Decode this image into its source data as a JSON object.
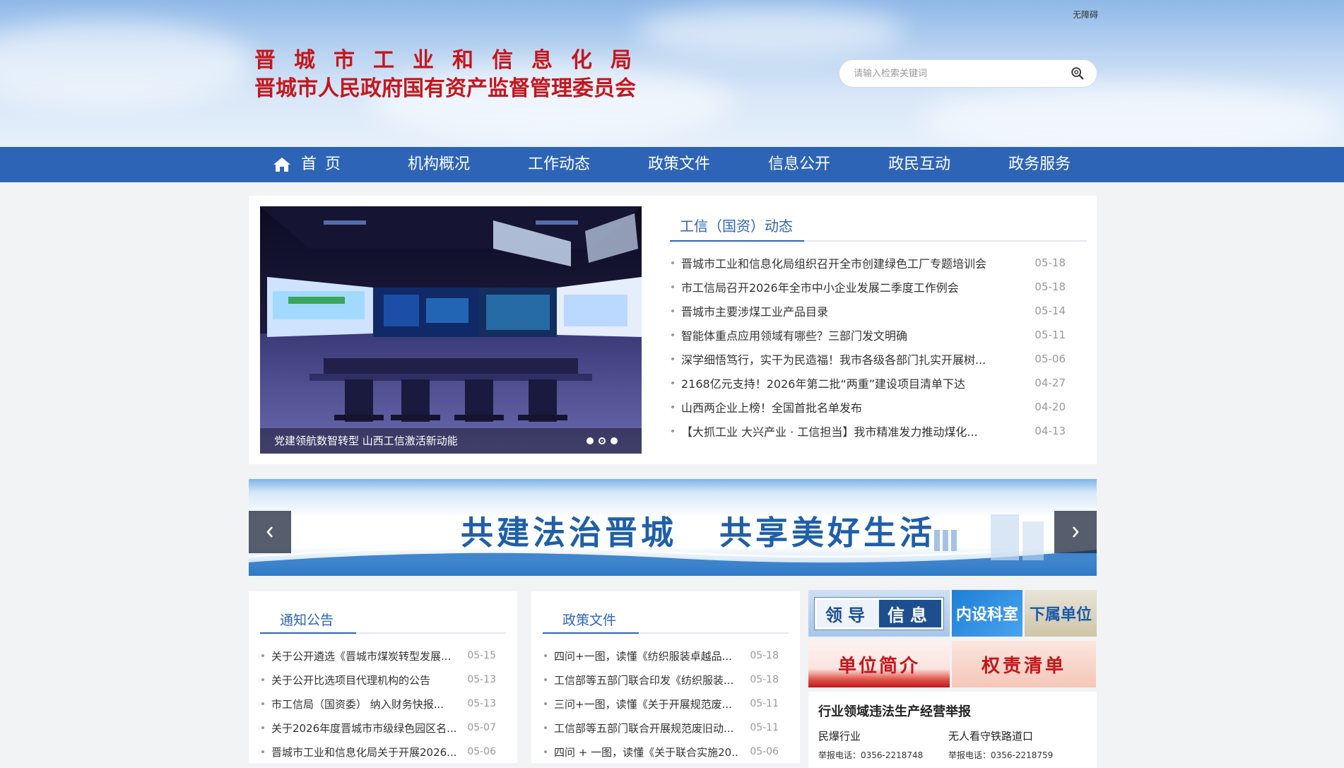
{
  "header": {
    "accessibility_label": "无障碍",
    "title_line1": "晋城市工业和信息化局",
    "title_line2": "晋城市人民政府国有资产监督管理委员会",
    "search_placeholder": "请输入检索关键词",
    "title_color": "#c4161c"
  },
  "nav": {
    "items": [
      {
        "label": "首页",
        "icon": "home-icon"
      },
      {
        "label": "机构概况"
      },
      {
        "label": "工作动态"
      },
      {
        "label": "政策文件"
      },
      {
        "label": "信息公开"
      },
      {
        "label": "政民互动"
      },
      {
        "label": "政务服务"
      }
    ],
    "bg_color": "#2d64b6"
  },
  "slider": {
    "caption": "党建领航数智转型 山西工信激活新动能",
    "active_dot": 1,
    "dot_count": 3
  },
  "news": {
    "title": "工信（国资）动态",
    "items": [
      {
        "text": "晋城市工业和信息化局组织召开全市创建绿色工厂专题培训会",
        "date": "05-18"
      },
      {
        "text": "市工信局召开2026年全市中小企业发展二季度工作例会",
        "date": "05-18"
      },
      {
        "text": "晋城市主要涉煤工业产品目录",
        "date": "05-14"
      },
      {
        "text": "智能体重点应用领域有哪些？三部门发文明确",
        "date": "05-11"
      },
      {
        "text": "深学细悟笃行，实干为民造福！我市各级各部门扎实开展树...",
        "date": "05-06"
      },
      {
        "text": "2168亿元支持！2026年第二批“两重”建设项目清单下达",
        "date": "04-27"
      },
      {
        "text": "山西两企业上榜！全国首批名单发布",
        "date": "04-20"
      },
      {
        "text": "【大抓工业 大兴产业 · 工信担当】我市精准发力推动煤化...",
        "date": "04-13"
      }
    ]
  },
  "banner": {
    "slogan_left": "共建法治晋城",
    "slogan_right": "共享美好生活"
  },
  "notices": {
    "title": "通知公告",
    "items": [
      {
        "text": "关于公开遴选《晋城市煤炭转型发展...",
        "date": "05-15"
      },
      {
        "text": "关于公开比选项目代理机构的公告",
        "date": "05-13"
      },
      {
        "text": "市工信局（国资委） 纳入财务快报...",
        "date": "05-13"
      },
      {
        "text": "关于2026年度晋城市市级绿色园区名...",
        "date": "05-07"
      },
      {
        "text": "晋城市工业和信息化局关于开展2026...",
        "date": "05-06"
      }
    ]
  },
  "policies": {
    "title": "政策文件",
    "items": [
      {
        "text": "四问+一图，读懂《纺织服装卓越品...",
        "date": "05-18"
      },
      {
        "text": "工信部等五部门联合印发《纺织服装...",
        "date": "05-18"
      },
      {
        "text": "三问+一图，读懂《关于开展规范废...",
        "date": "05-11"
      },
      {
        "text": "工信部等五部门联合开展规范废旧动...",
        "date": "05-11"
      },
      {
        "text": "四问 + 一图，读懂《关于联合实施20...",
        "date": "05-06"
      }
    ]
  },
  "quick_links": {
    "leader_a": "领导",
    "leader_b": "信息",
    "dept": "内设科室",
    "sub": "下属单位",
    "intro": "单位简介",
    "duty": "权责清单"
  },
  "report": {
    "title": "行业领域违法生产经营举报",
    "cols": [
      {
        "label": "民爆行业",
        "tel": "举报电话：0356-2218748"
      },
      {
        "label": "无人看守铁路道口",
        "tel": "举报电话：0356-2218759"
      }
    ]
  }
}
